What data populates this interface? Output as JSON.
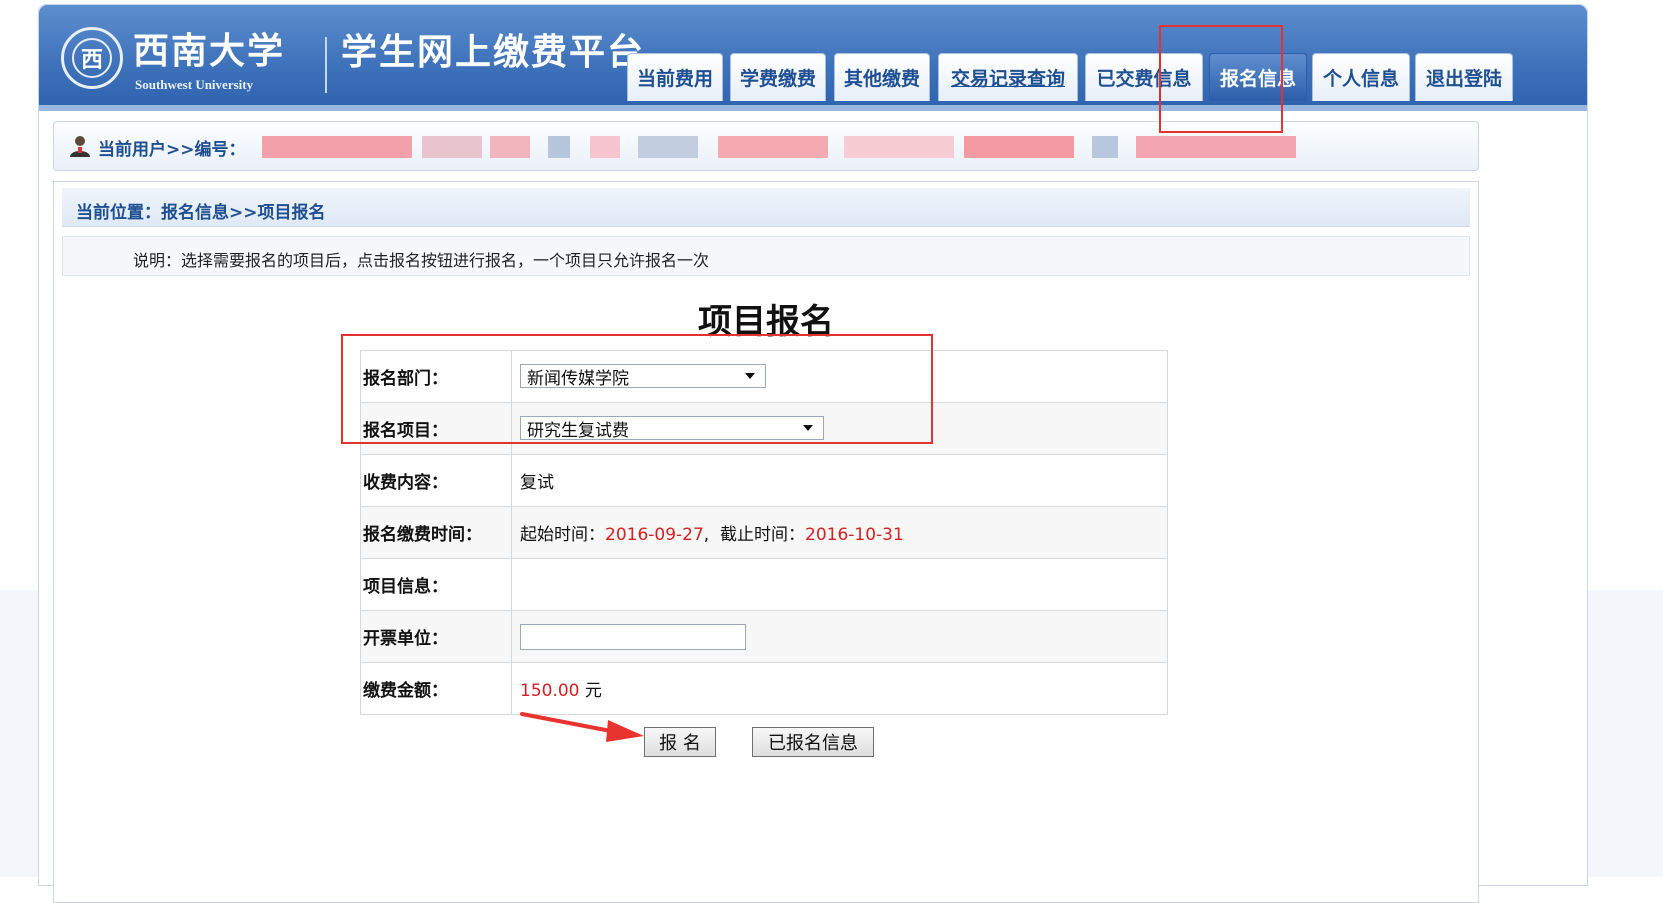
{
  "header": {
    "logo_glyph": "西",
    "university_name": "西南大学",
    "university_name_en": "Southwest University",
    "platform_title": "学生网上缴费平台"
  },
  "nav": {
    "items": [
      {
        "label": "当前费用"
      },
      {
        "label": "学费缴费"
      },
      {
        "label": "其他缴费"
      },
      {
        "label": "交易记录查询"
      },
      {
        "label": "已交费信息"
      },
      {
        "label": "报名信息"
      },
      {
        "label": "个人信息"
      },
      {
        "label": "退出登陆"
      }
    ],
    "active": "报名信息"
  },
  "userbar": {
    "label": "当前用户>>编号："
  },
  "breadcrumb": "当前位置：报名信息>>项目报名",
  "note": "说明：选择需要报名的项目后，点击报名按钮进行报名，一个项目只允许报名一次",
  "form": {
    "title": "项目报名",
    "department_label": "报名部门：",
    "department_value": "新闻传媒学院",
    "project_label": "报名项目：",
    "project_value": "研究生复试费",
    "content_label": "收费内容：",
    "content_value": "复试",
    "period_label": "报名缴费时间：",
    "start_label": "起始时间：",
    "start_value": "2016-09-27",
    "end_label": "截止时间：",
    "end_value": "2016-10-31",
    "info_label": "项目信息：",
    "info_value": "",
    "invoice_label": "开票单位：",
    "invoice_value": "",
    "amount_label": "缴费金额：",
    "amount_value": "150.00",
    "amount_unit": "元"
  },
  "buttons": {
    "register": "报 名",
    "registered_info": "已报名信息"
  },
  "colors": {
    "header_blue": "#3f73bb",
    "accent_red": "#d42020",
    "highlight_red": "#e23232"
  }
}
